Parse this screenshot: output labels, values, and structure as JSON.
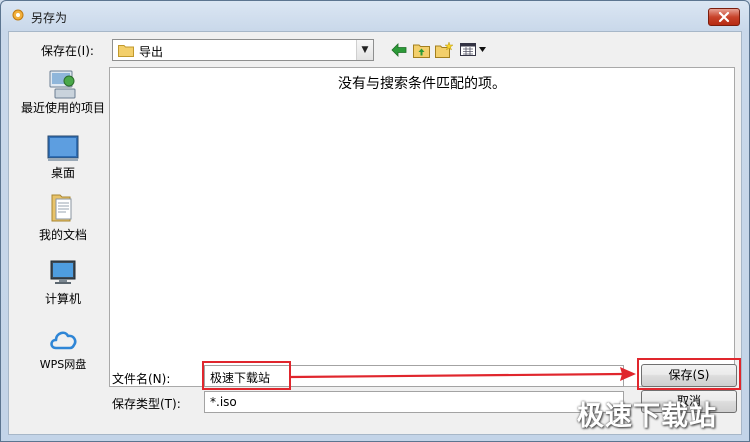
{
  "window": {
    "title": "另存为"
  },
  "toolbar": {
    "savein_label": "保存在(I):",
    "savein_value": "导出"
  },
  "places": [
    {
      "label": "最近使用的项目",
      "icon": "recent-items-icon"
    },
    {
      "label": "桌面",
      "icon": "desktop-icon"
    },
    {
      "label": "我的文档",
      "icon": "documents-icon"
    },
    {
      "label": "计算机",
      "icon": "computer-icon"
    },
    {
      "label": "WPS网盘",
      "icon": "cloud-icon"
    }
  ],
  "filelist": {
    "empty_message": "没有与搜索条件匹配的项。"
  },
  "form": {
    "filename_label": "文件名(N):",
    "filename_value": "极速下载站",
    "filetype_label": "保存类型(T):",
    "filetype_value": "*.iso"
  },
  "buttons": {
    "save": "保存(S)",
    "cancel": "取消"
  },
  "watermark": "极速下载站",
  "colors": {
    "annotation_red": "#e0262d"
  }
}
